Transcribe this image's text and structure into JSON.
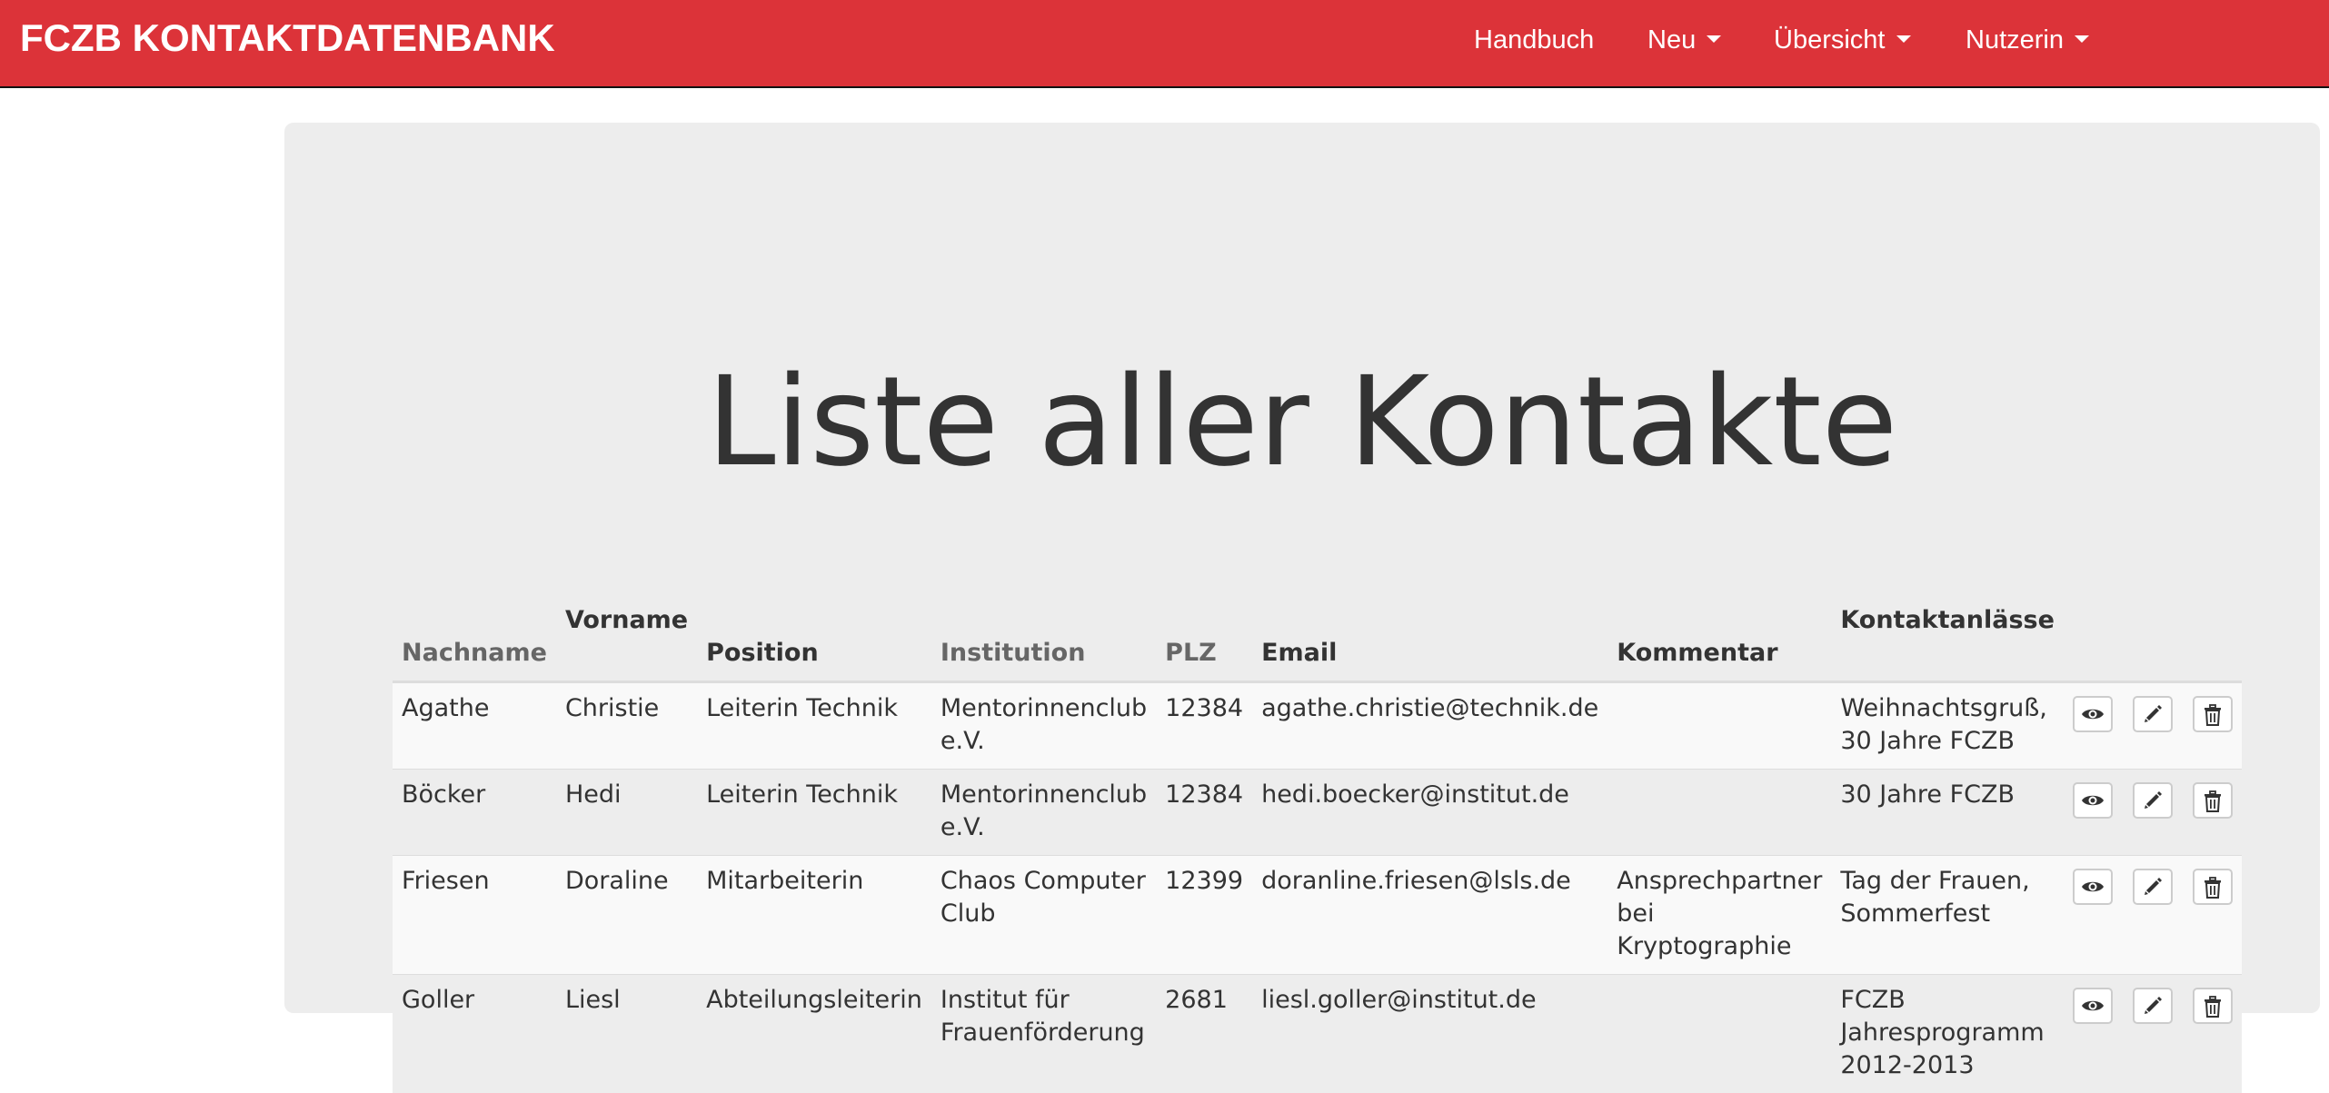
{
  "navbar": {
    "brand": "FCZB KONTAKTDATENBANK",
    "items": [
      {
        "label": "Handbuch",
        "dropdown": false
      },
      {
        "label": "Neu",
        "dropdown": true
      },
      {
        "label": "Übersicht",
        "dropdown": true
      },
      {
        "label": "Nutzerin",
        "dropdown": true
      }
    ]
  },
  "main": {
    "title": "Liste aller Kontakte"
  },
  "table": {
    "headers": [
      "Nachname",
      "Vorname",
      "Position",
      "Institution",
      "PLZ",
      "Email",
      "Kommentar",
      "Kontaktanlässe"
    ],
    "rows": [
      {
        "nachname": "Agathe",
        "vorname": "Christie",
        "position": "Leiterin Technik",
        "institution": "Mentorinnenclub e.V.",
        "plz": "12384",
        "email": "agathe.christie@technik.de",
        "kommentar": "",
        "anlaesse": "Weihnachtsgruß, 30 Jahre FCZB"
      },
      {
        "nachname": "Böcker",
        "vorname": "Hedi",
        "position": "Leiterin Technik",
        "institution": "Mentorinnenclub e.V.",
        "plz": "12384",
        "email": "hedi.boecker@institut.de",
        "kommentar": "",
        "anlaesse": "30 Jahre FCZB"
      },
      {
        "nachname": "Friesen",
        "vorname": "Doraline",
        "position": "Mitarbeiterin",
        "institution": "Chaos Computer Club",
        "plz": "12399",
        "email": "doranline.friesen@lsls.de",
        "kommentar": "Ansprechpartner bei Kryptographie",
        "anlaesse": "Tag der Frauen, Sommerfest"
      },
      {
        "nachname": "Goller",
        "vorname": "Liesl",
        "position": "Abteilungsleiterin",
        "institution": "Institut für Frauenförderung",
        "plz": "2681",
        "email": "liesl.goller@institut.de",
        "kommentar": "",
        "anlaesse": "FCZB Jahresprogramm 2012-2013"
      }
    ]
  },
  "colors": {
    "navbar_bg": "#dc3339",
    "jumbotron_bg": "#ededed",
    "sortable_header": "#666666"
  },
  "icons": {
    "view": "eye-icon",
    "edit": "pencil-icon",
    "delete": "trash-icon"
  }
}
